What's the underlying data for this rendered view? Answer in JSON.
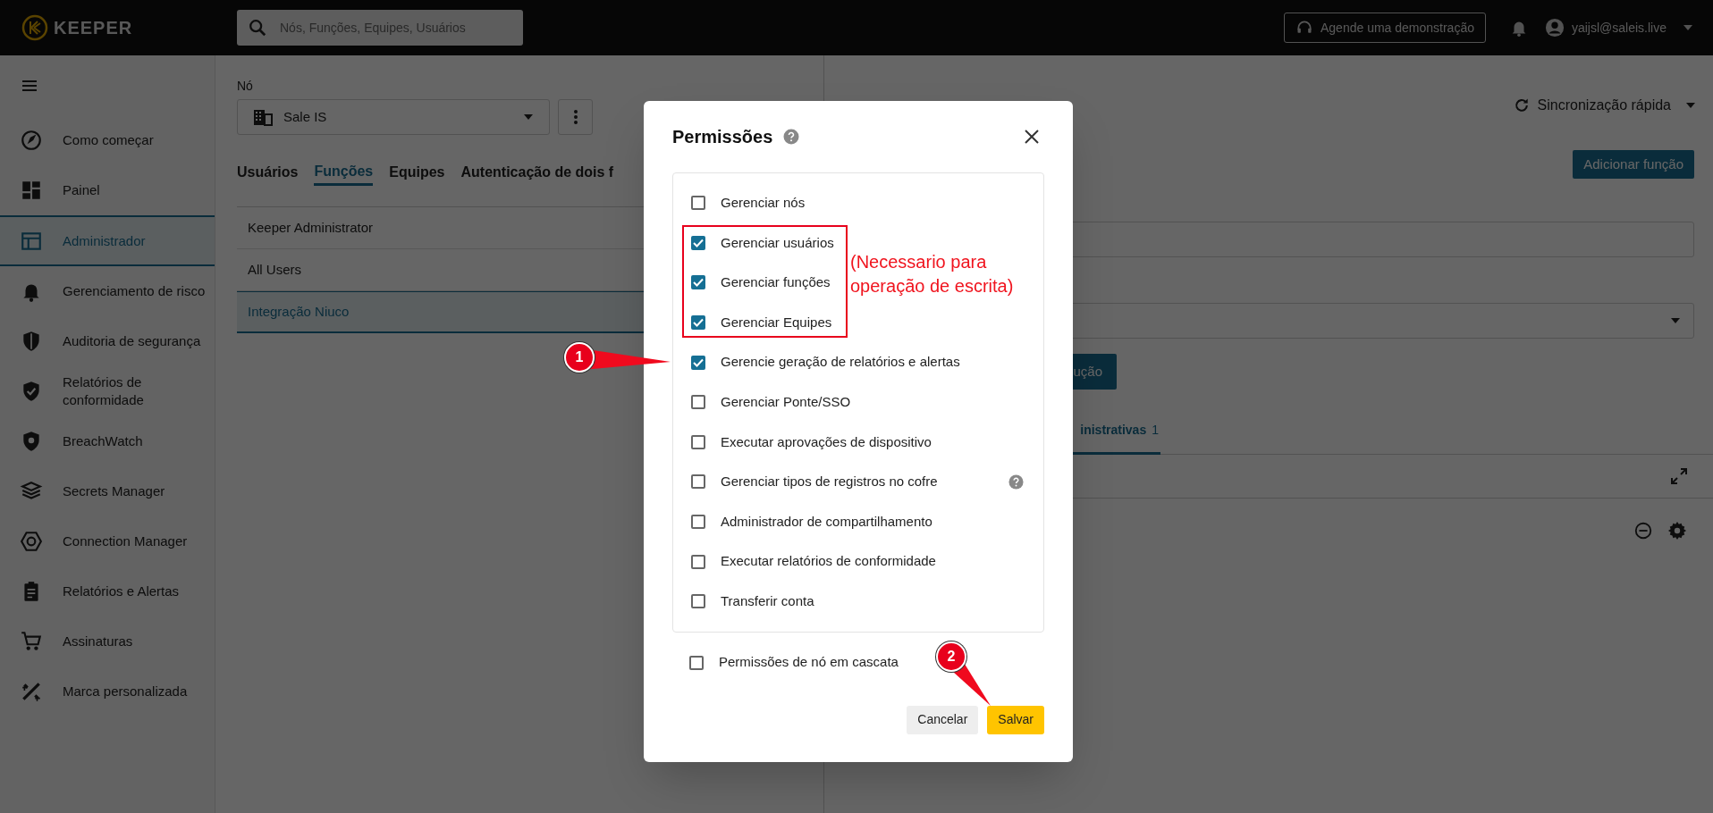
{
  "app": {
    "logo": "KEEPER"
  },
  "topbar": {
    "search": {
      "placeholder": "Nós, Funções, Equipes, Usuários"
    },
    "demo_button": "Agende uma demonstração",
    "user": "yaijsl@saleis.live"
  },
  "sidebar": {
    "items": [
      {
        "label": "Como começar",
        "selected": false
      },
      {
        "label": "Painel",
        "selected": false
      },
      {
        "label": "Administrador",
        "selected": true
      },
      {
        "label": "Gerenciamento de risco",
        "selected": false
      },
      {
        "label": "Auditoria de segurança",
        "selected": false
      },
      {
        "label": "Relatórios de conformidade",
        "selected": false
      },
      {
        "label": "BreachWatch",
        "selected": false
      },
      {
        "label": "Secrets Manager",
        "selected": false
      },
      {
        "label": "Connection Manager",
        "selected": false
      },
      {
        "label": "Relatórios e Alertas",
        "selected": false
      },
      {
        "label": "Assinaturas",
        "selected": false
      },
      {
        "label": "Marca personalizada",
        "selected": false
      }
    ]
  },
  "node": {
    "label": "Nó",
    "value": "Sale IS"
  },
  "tabs": [
    {
      "label": "Usuários",
      "selected": false
    },
    {
      "label": "Funções",
      "selected": true
    },
    {
      "label": "Equipes",
      "selected": false
    },
    {
      "label": "Autenticação de dois f",
      "selected": false
    }
  ],
  "roles": [
    {
      "name": "Keeper Administrator",
      "selected": false
    },
    {
      "name": "All Users",
      "selected": false
    },
    {
      "name": "Integração Niuco",
      "selected": true
    }
  ],
  "right_panel": {
    "sync": "Sincronização rápida",
    "add_button": "Adicionar função",
    "action_button": "ução",
    "tab": {
      "label": "inistrativas",
      "count": "1"
    }
  },
  "dialog": {
    "title": "Permissões",
    "permissions": [
      {
        "label": "Gerenciar nós",
        "checked": false,
        "help": false
      },
      {
        "label": "Gerenciar usuários",
        "checked": true,
        "help": false
      },
      {
        "label": "Gerenciar funções",
        "checked": true,
        "help": false
      },
      {
        "label": "Gerenciar Equipes",
        "checked": true,
        "help": false
      },
      {
        "label": "Gerencie geração de relatórios e alertas",
        "checked": true,
        "help": false
      },
      {
        "label": "Gerenciar Ponte/SSO",
        "checked": false,
        "help": false
      },
      {
        "label": "Executar aprovações de dispositivo",
        "checked": false,
        "help": false
      },
      {
        "label": "Gerenciar tipos de registros no cofre",
        "checked": false,
        "help": true
      },
      {
        "label": "Administrador de compartilhamento",
        "checked": false,
        "help": false
      },
      {
        "label": "Executar relatórios de conformidade",
        "checked": false,
        "help": false
      },
      {
        "label": "Transferir conta",
        "checked": false,
        "help": false
      }
    ],
    "cascade": {
      "label": "Permissões de nó em cascata",
      "checked": false
    },
    "cancel_button": "Cancelar",
    "save_button": "Salvar"
  },
  "annotations": {
    "note": "(Necessario para operação de escrita)",
    "callouts": [
      "1",
      "2"
    ]
  }
}
